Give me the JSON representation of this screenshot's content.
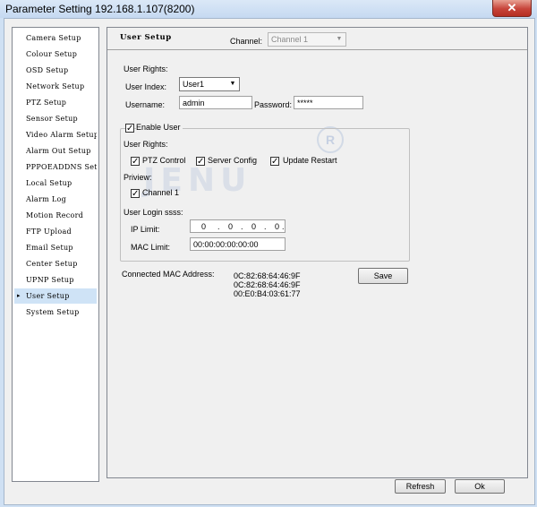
{
  "window": {
    "title": "Parameter Setting 192.168.1.107(8200)",
    "close_glyph": "✕"
  },
  "sidebar": {
    "items": [
      {
        "label": "Camera Setup"
      },
      {
        "label": "Colour Setup"
      },
      {
        "label": "OSD Setup"
      },
      {
        "label": "Network Setup"
      },
      {
        "label": "PTZ Setup"
      },
      {
        "label": "Sensor Setup"
      },
      {
        "label": "Video Alarm Setup"
      },
      {
        "label": "Alarm Out Setup"
      },
      {
        "label": "PPPOEADDNS Setup"
      },
      {
        "label": "Local Setup"
      },
      {
        "label": "Alarm Log"
      },
      {
        "label": "Motion Record"
      },
      {
        "label": "FTP Upload"
      },
      {
        "label": "Email Setup"
      },
      {
        "label": "Center Setup"
      },
      {
        "label": "UPNP Setup"
      },
      {
        "label": "User Setup",
        "selected": true,
        "bullet": "▸"
      },
      {
        "label": "System Setup"
      }
    ]
  },
  "panel": {
    "title": "User Setup",
    "channel_label": "Channel:",
    "channel_value": "Channel 1",
    "user_rights_label": "User Rights:",
    "user_index_label": "User Index:",
    "user_index_value": "User1",
    "username_label": "Username:",
    "username_value": "admin",
    "password_label": "Password:",
    "password_value": "*****",
    "enable_user_label": "Enable User",
    "enable_user_checked": true,
    "rights_label": "User Rights:",
    "rights": [
      {
        "label": "PTZ Control",
        "checked": true
      },
      {
        "label": "Server Config",
        "checked": true
      },
      {
        "label": "Update Restart",
        "checked": true
      }
    ],
    "preview_label": "Priview:",
    "channel1_label": "Channel 1",
    "channel1_checked": true,
    "login_label": "User Login ssss:",
    "ip_limit_label": "IP Limit:",
    "ip_octets": [
      "0",
      "0",
      "0",
      "0"
    ],
    "ip_dot": ".",
    "mac_limit_label": "MAC Limit:",
    "mac_limit_value": "00:00:00:00:00:00",
    "connected_mac_label": "Connected MAC Address:",
    "connected_macs": [
      "0C:82:68:64:46:9F",
      "0C:82:68:64:46:9F",
      "00:E0:B4:03:61:77"
    ],
    "save_label": "Save"
  },
  "footer": {
    "refresh_label": "Refresh",
    "ok_label": "Ok"
  },
  "watermark": {
    "text": "JENU",
    "registered": "R"
  },
  "colors": {
    "selected_row": "#cfe3f6",
    "close_button": "#c7443a"
  }
}
